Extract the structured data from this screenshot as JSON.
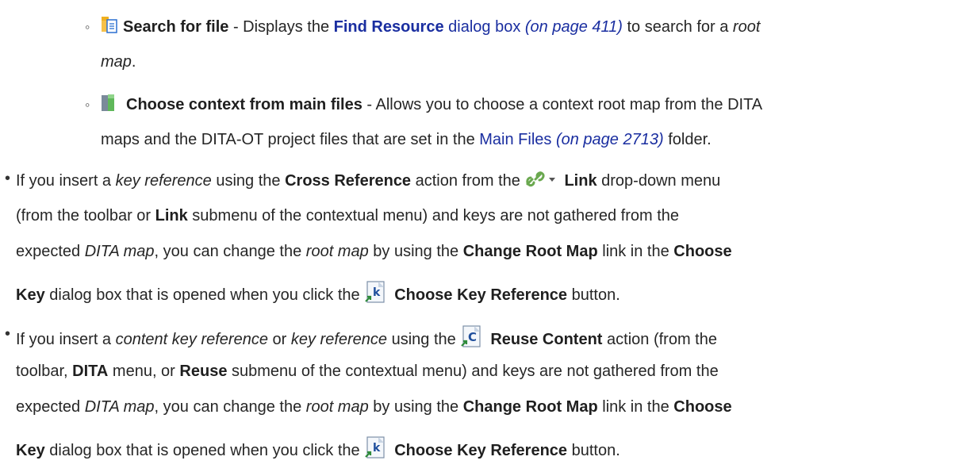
{
  "colors": {
    "text": "#262626",
    "link": "#1a2ea0",
    "page_bg": "#ffffff"
  },
  "items": [
    {
      "icon": "search-for-file-icon",
      "line1": {
        "b1": "Search for file",
        "t1": " - Displays the ",
        "link_bold": "Find Resource",
        "link_rest": " dialog box ",
        "link_page": "(on page 411)",
        "t2": " to search for a ",
        "i1": "root"
      },
      "line2": {
        "i1": "map",
        "t1": "."
      }
    },
    {
      "icon": "choose-context-icon",
      "line1": {
        "b1": "Choose context from main files",
        "t1": " - Allows you to choose a context root map from the DITA"
      },
      "line2": {
        "t1": "maps and the DITA-OT project files that are set in the ",
        "link": "Main Files",
        "link_page": "(on page 2713)",
        "t2": " folder."
      }
    }
  ],
  "bullets": [
    {
      "l1": {
        "t1": "If you insert a ",
        "i1": "key reference",
        "t2": " using the ",
        "b1": "Cross Reference",
        "t3": " action from the ",
        "icon": "link-icon",
        "icon2": "dropdown-arrow-icon",
        "b2": "Link",
        "t4": " drop-down menu"
      },
      "l2": {
        "t1": "(from the toolbar or ",
        "b1": "Link",
        "t2": " submenu of the contextual menu) and keys are not gathered from the"
      },
      "l3": {
        "t1": "expected ",
        "i1": "DITA map",
        "t2": ", you can change the ",
        "i2": "root map",
        "t3": " by using the ",
        "b1": "Change Root Map",
        "t4": " link in the ",
        "b2": "Choose"
      },
      "l4": {
        "b1": "Key",
        "t1": " dialog box that is opened when you click the ",
        "icon": "choose-key-reference-icon",
        "b2": "Choose Key Reference",
        "t2": " button."
      }
    },
    {
      "l1": {
        "t1": "If you insert a ",
        "i1": "content key reference",
        "t2": " or ",
        "i2": "key reference",
        "t3": " using the ",
        "icon": "reuse-content-icon",
        "b1": "Reuse Content",
        "t4": " action (from the"
      },
      "l2": {
        "t1": "toolbar, ",
        "b1": "DITA",
        "t2": " menu, or ",
        "b2": "Reuse",
        "t3": " submenu of the contextual menu) and keys are not gathered from the"
      },
      "l3": {
        "t1": "expected ",
        "i1": "DITA map",
        "t2": ", you can change the ",
        "i2": "root map",
        "t3": " by using the ",
        "b1": "Change Root Map",
        "t4": " link in the ",
        "b2": "Choose"
      },
      "l4": {
        "b1": "Key",
        "t1": " dialog box that is opened when you click the ",
        "icon": "choose-key-reference-icon",
        "b2": "Choose Key Reference",
        "t2": " button."
      }
    }
  ],
  "glyphs": {
    "sub_bullet": "◦",
    "main_bullet": "•"
  }
}
